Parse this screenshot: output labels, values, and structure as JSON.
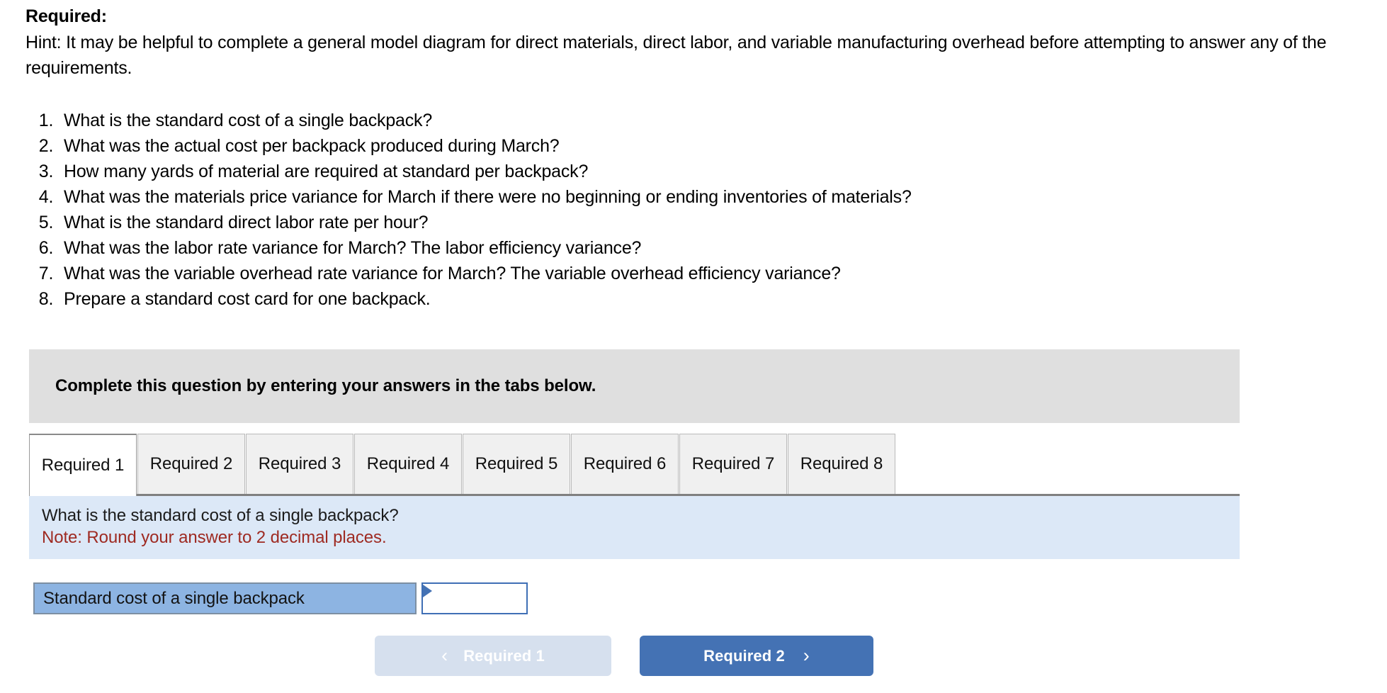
{
  "intro": {
    "heading": "Required:",
    "hint": "Hint:  It may be helpful to complete a general model diagram for direct materials, direct labor, and variable manufacturing overhead before attempting to answer any of the requirements."
  },
  "requirements": [
    "What is the standard cost of a single backpack?",
    "What was the actual cost per backpack produced during March?",
    "How many yards of material are required at standard per backpack?",
    "What was the materials price variance for March if there were no beginning or ending inventories of materials?",
    "What is the standard direct labor rate per hour?",
    "What was the labor rate variance for March? The labor efficiency variance?",
    "What was the variable overhead rate variance for March? The variable overhead efficiency variance?",
    "Prepare a standard cost card for one backpack."
  ],
  "instruction_bar": {
    "text": "Complete this question by entering your answers in the tabs below."
  },
  "tabs": [
    {
      "label": "Required 1",
      "active": true
    },
    {
      "label": "Required 2",
      "active": false
    },
    {
      "label": "Required 3",
      "active": false
    },
    {
      "label": "Required 4",
      "active": false
    },
    {
      "label": "Required 5",
      "active": false
    },
    {
      "label": "Required 6",
      "active": false
    },
    {
      "label": "Required 7",
      "active": false
    },
    {
      "label": "Required 8",
      "active": false
    }
  ],
  "question_panel": {
    "question": "What is the standard cost of a single backpack?",
    "note": "Note: Round your answer to 2 decimal places."
  },
  "answer_row": {
    "label": "Standard cost of a single backpack",
    "value": "",
    "placeholder": ""
  },
  "navigation": {
    "prev_label": "Required 1",
    "prev_icon": "chevron-left-icon",
    "prev_chevron": "‹",
    "next_label": "Required 2",
    "next_icon": "chevron-right-icon",
    "next_chevron": "›",
    "prev_disabled": true
  },
  "colors": {
    "instruction_bar_bg": "#dfdfdf",
    "question_panel_bg": "#dce8f7",
    "note_text": "#9e2a22",
    "answer_label_bg": "#8db4e2",
    "next_button_bg": "#4472b4",
    "prev_button_bg": "#d6e0ee",
    "input_border": "#3f6fb5",
    "tab_inactive_bg": "#f0f0f0",
    "tab_active_bg": "#ffffff"
  }
}
